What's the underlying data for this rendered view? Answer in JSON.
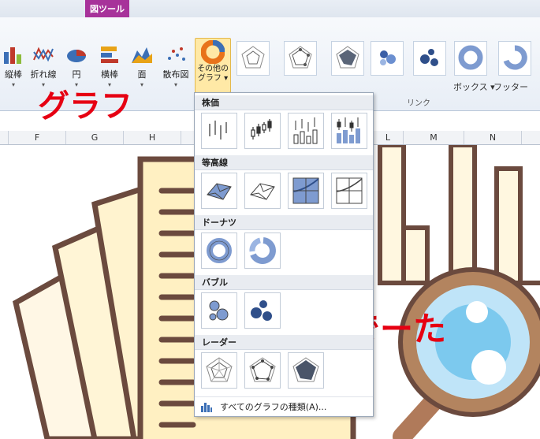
{
  "window": {
    "title_partial": "",
    "context_tab": "図ツール"
  },
  "ribbon": {
    "buttons": [
      {
        "name": "column",
        "label": "縦棒"
      },
      {
        "name": "line",
        "label": "折れ線"
      },
      {
        "name": "pie",
        "label": "円"
      },
      {
        "name": "bar",
        "label": "横棒"
      },
      {
        "name": "area",
        "label": "面"
      },
      {
        "name": "scatter",
        "label": "散布図"
      }
    ],
    "other_charts_label_line1": "その他の",
    "other_charts_label_line2": "グラフ ▾",
    "box_label": "ボックス ▾",
    "footer_label": "フッター",
    "group_link": "リンク"
  },
  "columns": [
    "F",
    "G",
    "H",
    "",
    "",
    "L",
    "M",
    "N"
  ],
  "annotations": {
    "graph": "グラフ",
    "deta": "でーた"
  },
  "dropdown": {
    "sections": [
      {
        "title": "株価"
      },
      {
        "title": "等高線"
      },
      {
        "title": "ドーナツ"
      },
      {
        "title": "バブル"
      },
      {
        "title": "レーダー"
      }
    ],
    "all_chart_types": "すべてのグラフの種類(A)..."
  }
}
